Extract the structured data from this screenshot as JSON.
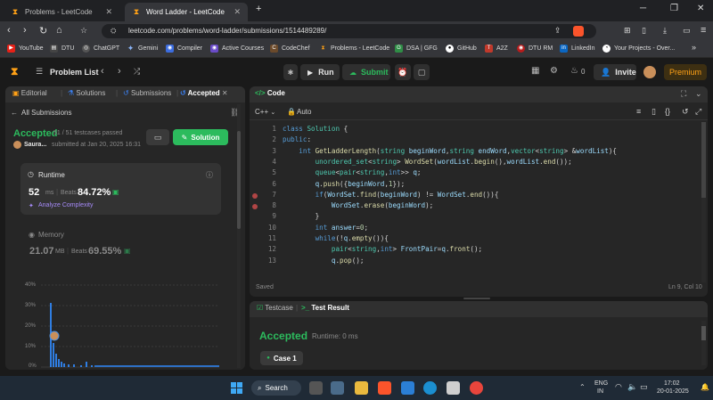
{
  "browser": {
    "tabs": [
      {
        "title": "Problems - LeetCode",
        "active": false
      },
      {
        "title": "Word Ladder - LeetCode",
        "active": true
      }
    ],
    "new_tab": "+",
    "url": "leetcode.com/problems/word-ladder/submissions/1514489289/",
    "bookmarks": [
      "YouTube",
      "DTU",
      "ChatGPT",
      "Gemini",
      "Compiler",
      "Active Courses",
      "CodeChef",
      "Problems - LeetCode",
      "DSA | GFG",
      "GitHub",
      "A2Z",
      "DTU RM",
      "LinkedIn",
      "Your Projects - Over..."
    ],
    "more": "»"
  },
  "nav": {
    "problem_list": "Problem List",
    "run": "Run",
    "submit": "Submit",
    "invite": "Invite",
    "premium": "Premium"
  },
  "left": {
    "tabs": [
      "Editorial",
      "Solutions",
      "Submissions",
      "Accepted"
    ],
    "all_submissions": "All Submissions",
    "status": "Accepted",
    "testcases": "51 / 51 testcases passed",
    "user": "Saura...",
    "submitted": "submitted at Jan 20, 2025 16:31",
    "solution_btn": "Solution",
    "runtime": {
      "label": "Runtime",
      "value": "52",
      "unit": "ms",
      "beats_label": "Beats",
      "beats": "84.72%",
      "analyze": "Analyze Complexity"
    },
    "memory": {
      "label": "Memory",
      "value": "21.07",
      "unit": "MB",
      "beats_label": "Beats",
      "beats": "69.55%"
    },
    "histogram_ticks": [
      "40%",
      "30%",
      "20%",
      "10%",
      "0%"
    ]
  },
  "code": {
    "title": "Code",
    "lang": "C++",
    "auto": "Auto",
    "saved": "Saved",
    "position": "Ln 9, Col 10"
  },
  "bottom": {
    "tabs": [
      "Testcase",
      "Test Result"
    ],
    "result": "Accepted",
    "runtime": "Runtime: 0 ms",
    "case": "Case 1"
  },
  "taskbar": {
    "search": "Search",
    "lang": "ENG",
    "region": "IN",
    "time": "17:02",
    "date": "20-01-2025"
  },
  "colors": {
    "accent_green": "#2cbb5d",
    "leetcode_orange": "#ffa116",
    "panel_bg": "#262626"
  }
}
